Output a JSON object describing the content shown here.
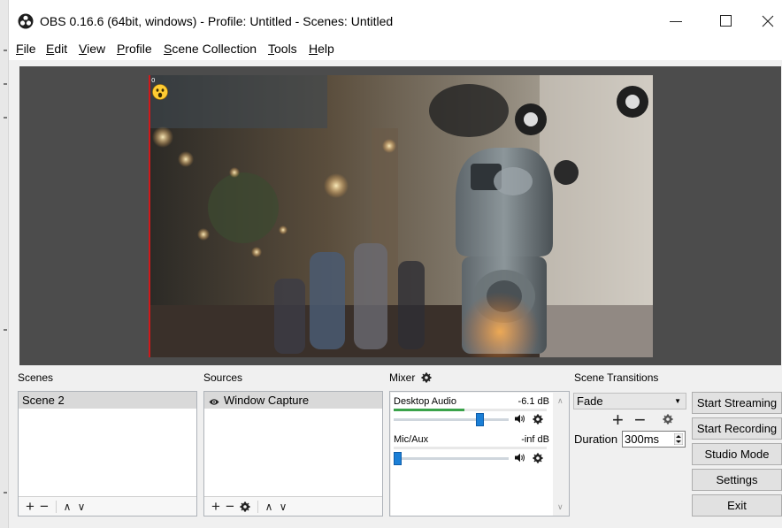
{
  "window": {
    "title": "OBS 0.16.6 (64bit, windows) - Profile: Untitled - Scenes: Untitled",
    "app_icon": "obs-logo-icon",
    "controls": [
      "minimize-icon",
      "maximize-icon",
      "close-icon"
    ]
  },
  "menu": {
    "items": [
      {
        "label": "File",
        "accel": "F",
        "rest": "ile"
      },
      {
        "label": "Edit",
        "accel": "E",
        "rest": "dit"
      },
      {
        "label": "View",
        "accel": "V",
        "rest": "iew"
      },
      {
        "label": "Profile",
        "accel": "P",
        "rest": "rofile"
      },
      {
        "label": "Scene Collection",
        "accel": "S",
        "rest": "cene Collection"
      },
      {
        "label": "Tools",
        "accel": "T",
        "rest": "ools"
      },
      {
        "label": "Help",
        "accel": "H",
        "rest": "elp"
      }
    ]
  },
  "preview": {
    "source_label": "0",
    "image": "street-parking-meter-photo",
    "overlay_icon": "surprised-face-emoji-icon"
  },
  "scenes": {
    "title": "Scenes",
    "items": [
      {
        "label": "Scene 2",
        "selected": true
      }
    ],
    "toolbar": [
      "add-icon",
      "remove-icon",
      "move-up-icon",
      "move-down-icon"
    ]
  },
  "sources": {
    "title": "Sources",
    "items": [
      {
        "label": "Window Capture",
        "visible": true,
        "icon": "eye-icon"
      }
    ],
    "toolbar": [
      "add-icon",
      "remove-icon",
      "gear-icon",
      "move-up-icon",
      "move-down-icon"
    ]
  },
  "mixer": {
    "title": "Mixer",
    "channels": [
      {
        "name": "Desktop Audio",
        "db": "-6.1 dB",
        "fader_level": 0.77,
        "meter_level": 0.46
      },
      {
        "name": "Mic/Aux",
        "db": "-inf dB",
        "fader_level": 0.0,
        "meter_level": 0.0
      }
    ]
  },
  "transitions": {
    "title": "Scene Transitions",
    "selected": "Fade",
    "duration_label": "Duration",
    "duration_value": "300ms"
  },
  "controls": {
    "start_streaming": "Start Streaming",
    "start_recording": "Start Recording",
    "studio_mode": "Studio Mode",
    "settings": "Settings",
    "exit": "Exit"
  },
  "colors": {
    "accent": "#1b7fd6",
    "meter_green": "#3aa24a",
    "preview_bg": "#4c4c4c",
    "source_border": "#d0191b"
  }
}
